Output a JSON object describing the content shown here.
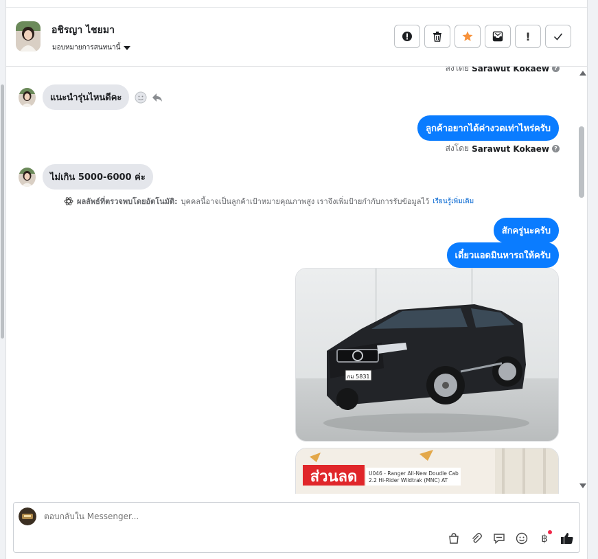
{
  "header": {
    "contact_name": "อชิรญา ไชยมา",
    "assign_label": "มอบหมายการสนทนานี้",
    "actions": [
      {
        "icon": "alert-circle-icon",
        "glyph": "●"
      },
      {
        "icon": "trash-icon",
        "glyph": "🗑"
      },
      {
        "icon": "star-icon",
        "glyph": "★"
      },
      {
        "icon": "archive-icon",
        "glyph": "✉"
      },
      {
        "icon": "exclamation-icon",
        "glyph": "!"
      },
      {
        "icon": "check-icon",
        "glyph": "✓"
      }
    ]
  },
  "messages": {
    "sent_by_prefix": "ส่งโดย",
    "agent_name": "Sarawut Kokaew",
    "msg1_in": "แนะนำรุ่นไหนดีคะ",
    "msg2_out": "ลูกค้าอยากได้ค่างวดเท่าไหร่ครับ",
    "msg3_in": "ไม่เกิน 5000-6000 ค่ะ",
    "ai_note_title": "ผลลัพธ์ที่ตรวจพบโดยอัตโนมัติ:",
    "ai_note_body": "บุคคลนี้อาจเป็นลูกค้าเป้าหมายคุณภาพสูง เราจึงเพิ่มป้ายกำกับการรับข้อมูลไว้",
    "ai_note_link": "เรียนรู้เพิ่มเติม",
    "msg4_out": "สักครู่นะครับ",
    "msg5_out": "เดี๋ยวแอดมินหารถให้ครับ",
    "img2_banner": "ส่วนลด",
    "img2_caption1": "U046 - Ranger All-New Doudle Cab",
    "img2_caption2": "2.2 Hi-Rider Wildtrak (MNC) AT",
    "plate_text": "กม 5831"
  },
  "composer": {
    "placeholder": "ตอบกลับใน Messenger...",
    "tools": [
      "shopping-bag-icon",
      "paperclip-icon",
      "saved-reply-icon",
      "emoji-icon",
      "baht-icon",
      "like-icon"
    ]
  },
  "colors": {
    "outgoing_bubble": "#0a7cff",
    "incoming_bubble": "#e4e6eb",
    "star": "#f7923b"
  }
}
